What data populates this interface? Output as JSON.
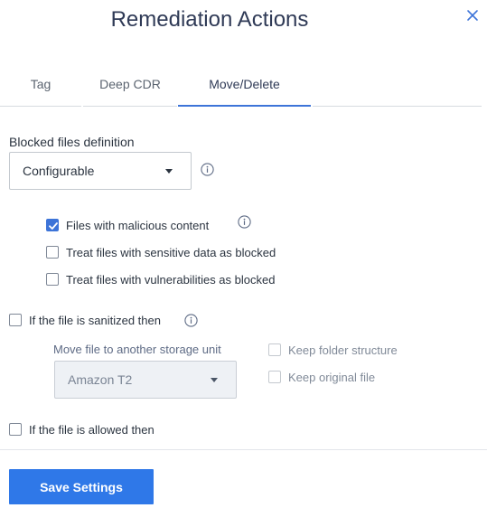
{
  "dialog": {
    "title": "Remediation Actions"
  },
  "tabs": [
    {
      "label": "Tag",
      "active": false
    },
    {
      "label": "Deep CDR",
      "active": false
    },
    {
      "label": "Move/Delete",
      "active": true
    }
  ],
  "blocked": {
    "label": "Blocked files definition",
    "select_value": "Configurable",
    "options": [
      {
        "label": "Files with malicious content",
        "checked": true
      },
      {
        "label": "Treat files with sensitive data as blocked",
        "checked": false
      },
      {
        "label": "Treat files with vulnerabilities as blocked",
        "checked": false
      }
    ]
  },
  "sanitized": {
    "label": "If the file is sanitized then",
    "checked": false,
    "move_label": "Move file to another storage unit",
    "storage_value": "Amazon T2",
    "keep_folder_label": "Keep folder structure",
    "keep_original_label": "Keep original file"
  },
  "allowed": {
    "label": "If the file is allowed then",
    "checked": false
  },
  "footer": {
    "save_label": "Save Settings"
  },
  "colors": {
    "accent": "#3d74d8",
    "button": "#2f78e8",
    "title": "#2f3a56"
  }
}
